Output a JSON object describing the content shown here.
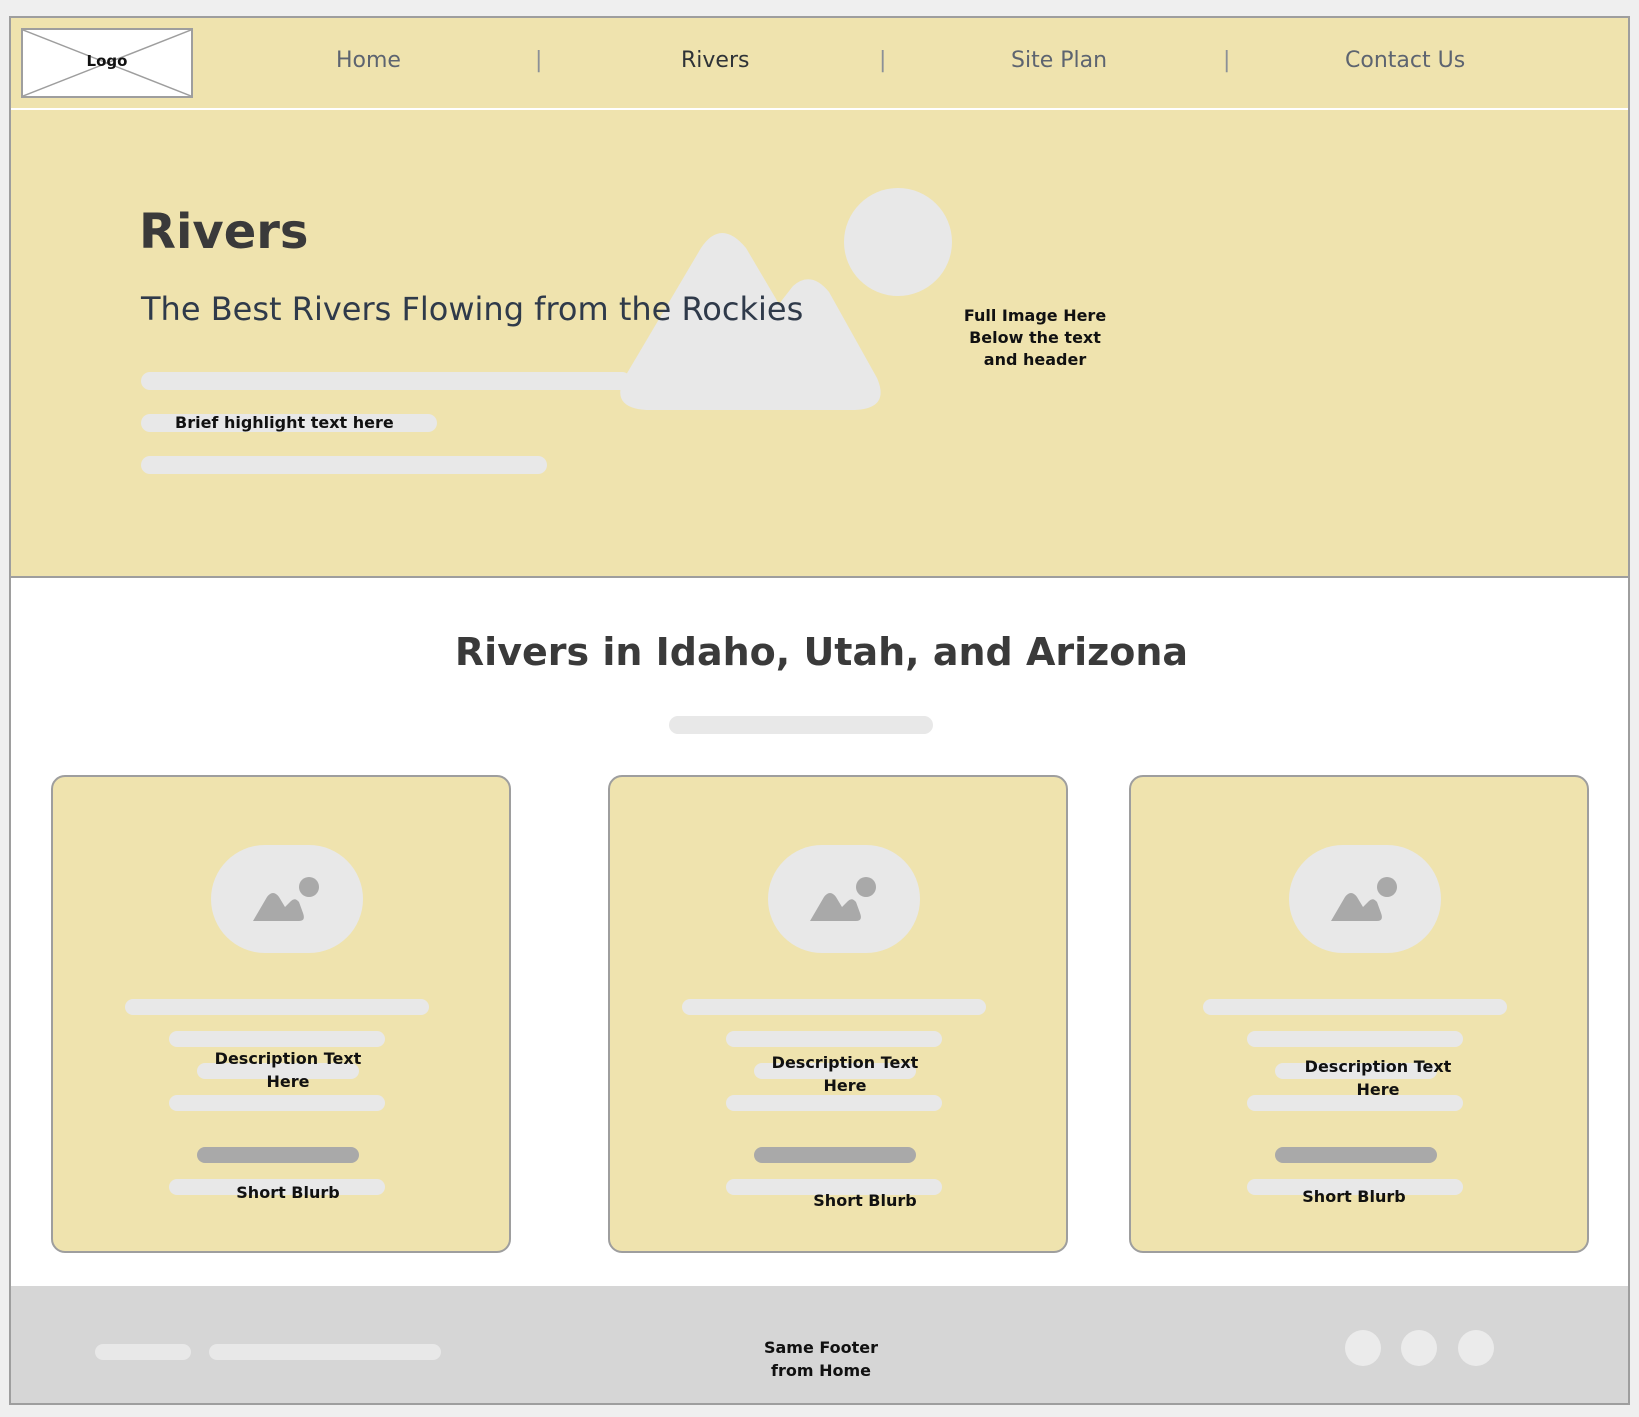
{
  "nav": {
    "logo_label": "Logo",
    "links": [
      "Home",
      "Rivers",
      "Site Plan",
      "Contact Us"
    ],
    "separator": "|",
    "active": "Rivers"
  },
  "hero": {
    "title": "Rivers",
    "subtitle": "The Best Rivers Flowing from the Rockies",
    "highlight": "Brief highlight text here",
    "image_note": "Full Image Here\nBelow the text\nand header"
  },
  "section": {
    "title": "Rivers in Idaho, Utah, and Arizona"
  },
  "cards": [
    {
      "description": "Description Text\nHere",
      "blurb": "Short Blurb"
    },
    {
      "description": "Description Text\nHere",
      "blurb": "Short Blurb"
    },
    {
      "description": "Description Text\nHere",
      "blurb": "Short Blurb"
    }
  ],
  "footer": {
    "text": "Same Footer\nfrom Home",
    "social_icons": [
      "social-icon",
      "social-icon",
      "social-icon"
    ]
  },
  "colors": {
    "accent": "#efe3ae",
    "placeholder": "#e8e8e8",
    "border": "#9e9e9e",
    "footer": "#d6d6d6"
  }
}
